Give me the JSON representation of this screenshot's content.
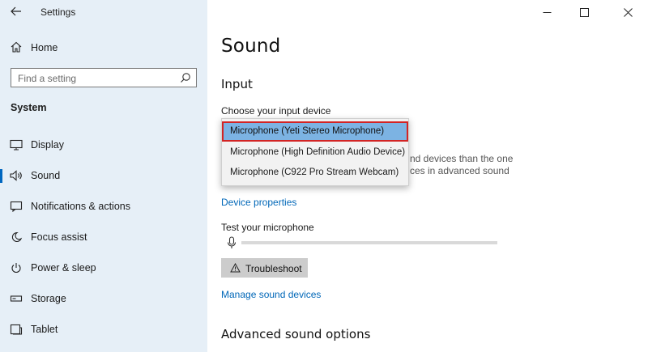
{
  "window": {
    "title": "Settings"
  },
  "nav": {
    "home": "Home",
    "search_placeholder": "Find a setting",
    "section": "System",
    "items": [
      {
        "label": "Display",
        "icon": "display-icon"
      },
      {
        "label": "Sound",
        "icon": "speaker-icon",
        "selected": true
      },
      {
        "label": "Notifications & actions",
        "icon": "notification-icon"
      },
      {
        "label": "Focus assist",
        "icon": "moon-icon"
      },
      {
        "label": "Power & sleep",
        "icon": "power-icon"
      },
      {
        "label": "Storage",
        "icon": "storage-icon"
      },
      {
        "label": "Tablet",
        "icon": "tablet-icon"
      }
    ]
  },
  "main": {
    "title": "Sound",
    "input_heading": "Input",
    "choose_device_label": "Choose your input device",
    "dropdown_options": [
      {
        "label": "Microphone (Yeti Stereo Microphone)",
        "selected": true
      },
      {
        "label": "Microphone (High Definition Audio Device)",
        "selected": false
      },
      {
        "label": "Microphone (C922 Pro Stream Webcam)",
        "selected": false
      }
    ],
    "obscured_text_line1": "nd devices than the one",
    "obscured_text_line2": "ces in advanced sound",
    "device_properties_link": "Device properties",
    "test_mic_label": "Test your microphone",
    "mic_level": 0,
    "troubleshoot_label": "Troubleshoot",
    "manage_link": "Manage sound devices",
    "advanced_heading": "Advanced sound options"
  },
  "colors": {
    "nav_bg": "#e6eff7",
    "accent": "#0067c0",
    "link": "#0067b8",
    "selected_option_bg": "#7cb3e3",
    "highlight_border": "#d32424"
  }
}
